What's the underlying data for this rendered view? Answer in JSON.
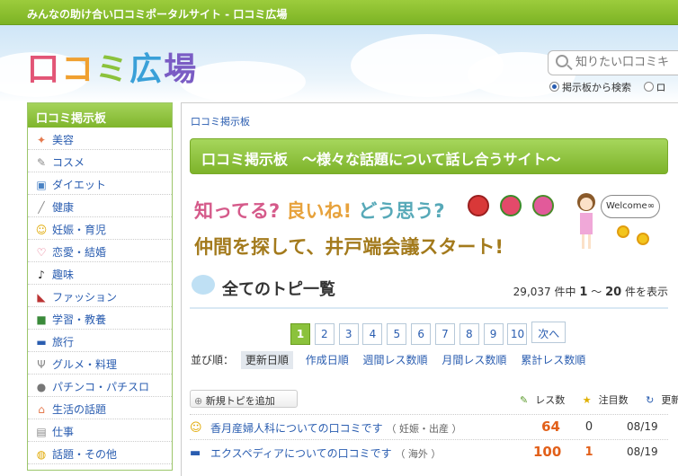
{
  "site": {
    "tagline": "みんなの助け合い口コミポータルサイト - 口コミ広場",
    "logo_chars": [
      "口",
      "コ",
      "ミ",
      "広",
      "場"
    ]
  },
  "search": {
    "placeholder": "知りたい口コミキ",
    "radio_board": "掲示板から検索",
    "radio_other": "ロ"
  },
  "sidebar": {
    "title": "口コミ掲示板",
    "items": [
      {
        "label": "美容",
        "icon": "sparkle-icon"
      },
      {
        "label": "コスメ",
        "icon": "lipstick-icon"
      },
      {
        "label": "ダイエット",
        "icon": "scale-icon"
      },
      {
        "label": "健康",
        "icon": "syringe-icon"
      },
      {
        "label": "妊娠・育児",
        "icon": "smiley-icon"
      },
      {
        "label": "恋愛・結婚",
        "icon": "heart-icon"
      },
      {
        "label": "趣味",
        "icon": "music-note-icon"
      },
      {
        "label": "ファッション",
        "icon": "heel-icon"
      },
      {
        "label": "学習・教養",
        "icon": "book-icon"
      },
      {
        "label": "旅行",
        "icon": "car-icon"
      },
      {
        "label": "グルメ・料理",
        "icon": "cutlery-icon"
      },
      {
        "label": "パチンコ・パチスロ",
        "icon": "ball-icon"
      },
      {
        "label": "生活の話題",
        "icon": "house-icon"
      },
      {
        "label": "仕事",
        "icon": "keyboard-icon"
      },
      {
        "label": "話題・その他",
        "icon": "speech-bubble-icon"
      }
    ]
  },
  "main": {
    "breadcrumb": "口コミ掲示板",
    "banner_title": "口コミ掲示板　～様々な話題について話し合うサイト～",
    "promo_line1": [
      "知ってる?",
      "良いね!",
      "どう思う?"
    ],
    "promo_line2": "仲間を探して、井戸端会議スタート!",
    "welcome": "Welcome∞",
    "list_title": "全てのトピ一覧",
    "count_total": "29,037",
    "count_mid": "件中",
    "count_from": "1",
    "count_tilde": "～",
    "count_to": "20",
    "count_suffix": "件を表示",
    "pages": [
      "1",
      "2",
      "3",
      "4",
      "5",
      "6",
      "7",
      "8",
      "9",
      "10"
    ],
    "current_page": "1",
    "next_label": "次へ",
    "sort_label": "並び順：",
    "sort_options": [
      "更新日順",
      "作成日順",
      "週間レス数順",
      "月間レス数順",
      "累計レス数順"
    ],
    "sort_selected": "更新日順",
    "new_topic": "新規トピを追加",
    "legend_res": "レス数",
    "legend_watch": "注目数",
    "legend_updated": "更新日",
    "topics": [
      {
        "icon": "smiley-icon",
        "title": "香月産婦人科についての口コミです",
        "category": "（ 妊娠・出産 ）",
        "res": "64",
        "watch": "0",
        "date": "08/19"
      },
      {
        "icon": "car-icon",
        "title": "エクスペディアについての口コミです",
        "category": "（ 海外 ）",
        "res": "100",
        "watch": "1",
        "date": "08/19"
      }
    ]
  },
  "colors": {
    "green": "#8bc23c",
    "link": "#2a5db0",
    "count_orange": "#e2601a"
  }
}
